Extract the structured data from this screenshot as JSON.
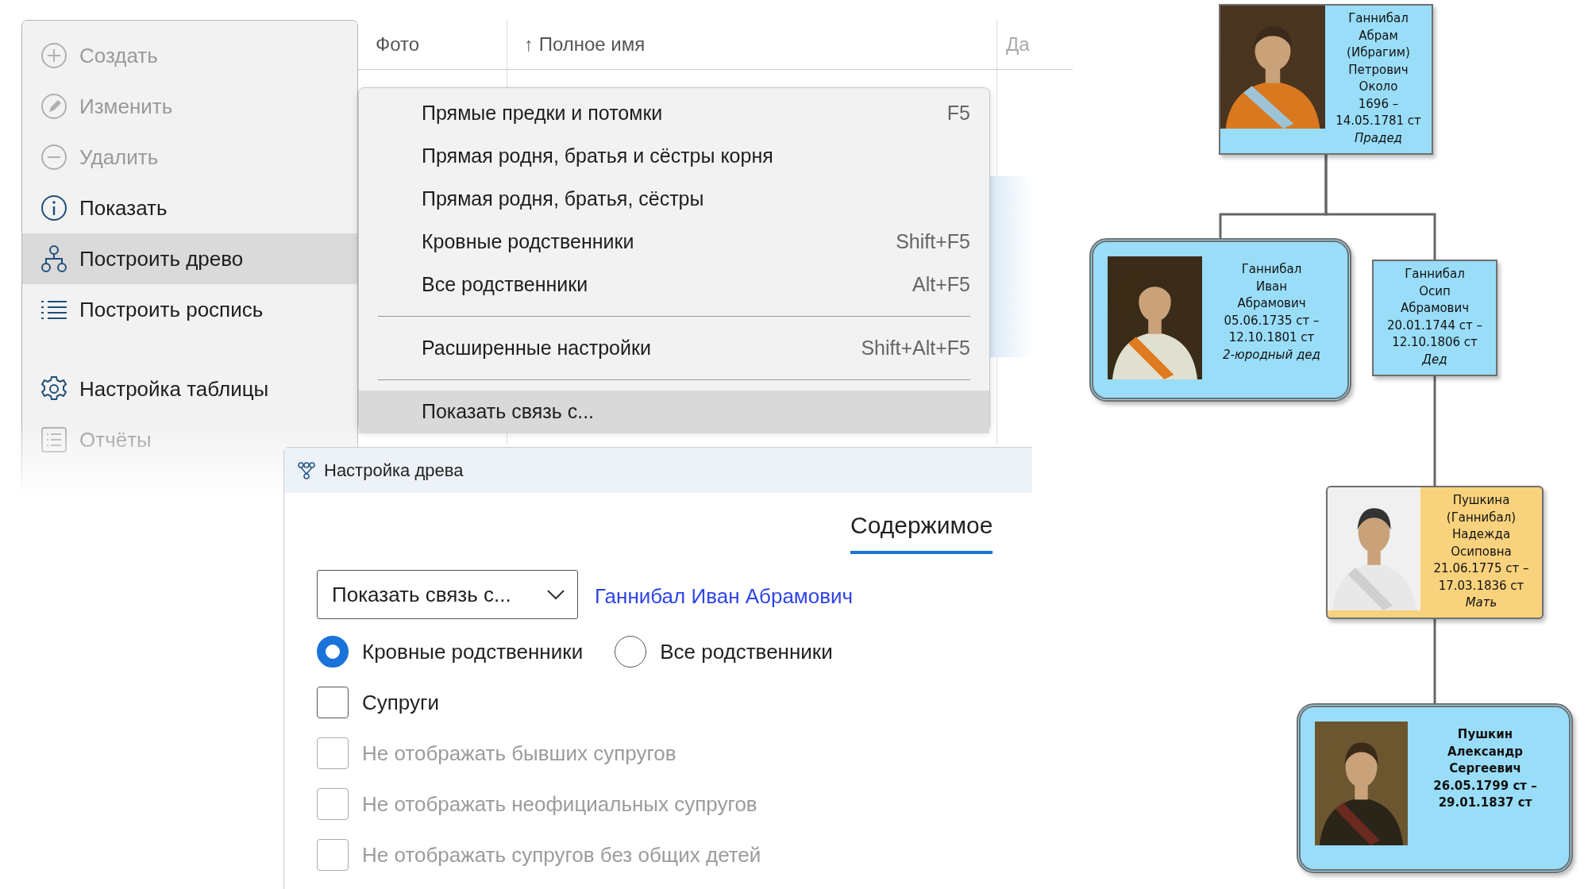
{
  "sidebar": {
    "groups": [
      [
        {
          "label": "Создать",
          "disabled": true,
          "selected": false
        },
        {
          "label": "Изменить",
          "disabled": true,
          "selected": false
        },
        {
          "label": "Удалить",
          "disabled": true,
          "selected": false
        },
        {
          "label": "Показать",
          "disabled": false,
          "selected": false
        },
        {
          "label": "Построить древо",
          "disabled": false,
          "selected": true
        },
        {
          "label": "Построить роспись",
          "disabled": false,
          "selected": false
        }
      ],
      [
        {
          "label": "Настройка таблицы",
          "disabled": false,
          "selected": false
        },
        {
          "label": "Отчёты",
          "disabled": true,
          "selected": false
        }
      ]
    ]
  },
  "table": {
    "columns": [
      "Фото",
      "↑ Полное имя",
      "Да"
    ]
  },
  "context_menu": {
    "groups": [
      [
        {
          "label": "Прямые предки и потомки",
          "shortcut": "F5",
          "selected": false
        },
        {
          "label": "Прямая родня, братья и сёстры корня",
          "selected": false
        },
        {
          "label": "Прямая родня, братья, сёстры",
          "selected": false
        },
        {
          "label": "Кровные родственники",
          "shortcut": "Shift+F5",
          "selected": false
        },
        {
          "label": "Все родственники",
          "shortcut": "Alt+F5",
          "selected": false
        }
      ],
      [
        {
          "label": "Расширенные настройки",
          "shortcut": "Shift+Alt+F5",
          "selected": false
        }
      ],
      [
        {
          "label": "Показать связь с...",
          "selected": true
        }
      ]
    ]
  },
  "dialog": {
    "title": "Настройка древа",
    "tabs": [
      {
        "label": "Содержимое",
        "selected": true
      }
    ],
    "mode_dropdown": {
      "value": "Показать связь с..."
    },
    "person_link": "Ганнибал Иван Абрамович",
    "radios": [
      {
        "label": "Кровные родственники",
        "selected": true
      },
      {
        "label": "Все родственники",
        "selected": false
      }
    ],
    "checkboxes": [
      {
        "label": "Супруги",
        "checked": false,
        "disabled": false
      },
      {
        "label": "Не отображать бывших супругов",
        "checked": false,
        "disabled": true
      },
      {
        "label": "Не отображать неофициальных супругов",
        "checked": false,
        "disabled": true
      },
      {
        "label": "Не отображать супругов без общих детей",
        "checked": false,
        "disabled": true
      }
    ]
  },
  "tree": {
    "root": {
      "name": "Ганнибал\nАбрам\n(Ибрагим)\nПетрович",
      "dates": "Около\n1696 –\n14.05.1781 ст",
      "relation": "Прадед",
      "kind": "plain",
      "color": "#99ddf8",
      "selected": false,
      "portrait": {
        "kind": "picture"
      },
      "children": [
        {
          "name": "Ганнибал\nИван\nАбрамович",
          "dates": "05.06.1735 ст –\n12.10.1801 ст",
          "relation": "2-юродный дед",
          "kind": "ornate",
          "color": "#99ddf8",
          "selected": false,
          "portrait": {
            "kind": "picture"
          }
        },
        {
          "name": "Ганнибал\nОсип\nАбрамович",
          "dates": "20.01.1744 ст –\n12.10.1806 ст",
          "relation": "Дед",
          "kind": "plain",
          "color": "#99ddf8",
          "selected": false,
          "children": [
            {
              "name": "Пушкина\n(Ганнибал)\nНадежда\nОсиповна",
              "dates": "21.06.1775 ст –\n17.03.1836 ст",
              "relation": "Мать",
              "kind": "rounded",
              "color": "#f9d27d",
              "selected": false,
              "portrait": {
                "kind": "picture"
              },
              "children": [
                {
                  "name": "Пушкин\nАлександр\nСергеевич",
                  "dates": "26.05.1799 ст –\n29.01.1837 ст",
                  "kind": "ornate",
                  "color": "#99ddf8",
                  "selected": true,
                  "portrait": {
                    "kind": "picture"
                  }
                }
              ]
            }
          ]
        }
      ]
    }
  }
}
